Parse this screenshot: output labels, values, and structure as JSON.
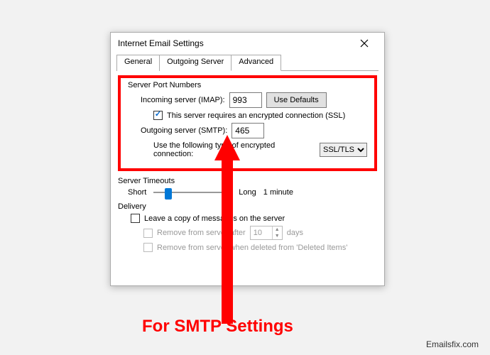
{
  "dialog": {
    "title": "Internet Email Settings",
    "tabs": {
      "general": "General",
      "outgoing": "Outgoing Server",
      "advanced": "Advanced"
    }
  },
  "serverPorts": {
    "legend": "Server Port Numbers",
    "incomingLabel": "Incoming server (IMAP):",
    "incomingPort": "993",
    "useDefaults": "Use Defaults",
    "sslCheck": "This server requires an encrypted connection (SSL)",
    "outgoingLabel": "Outgoing server (SMTP):",
    "outgoingPort": "465",
    "encLabel": "Use the following type of encrypted connection:",
    "encValue": "SSL/TLS"
  },
  "timeouts": {
    "legend": "Server Timeouts",
    "short": "Short",
    "long": "Long",
    "value": "1 minute"
  },
  "delivery": {
    "legend": "Delivery",
    "leaveCopy": "Leave a copy of messages on the server",
    "removeAfter": "Remove from server after",
    "removeDays": "10",
    "daysLabel": "days",
    "removeDeleted": "Remove from server when deleted from 'Deleted Items'"
  },
  "annotation": {
    "caption": "For SMTP Settings"
  },
  "watermark": "Emailsfix.com"
}
